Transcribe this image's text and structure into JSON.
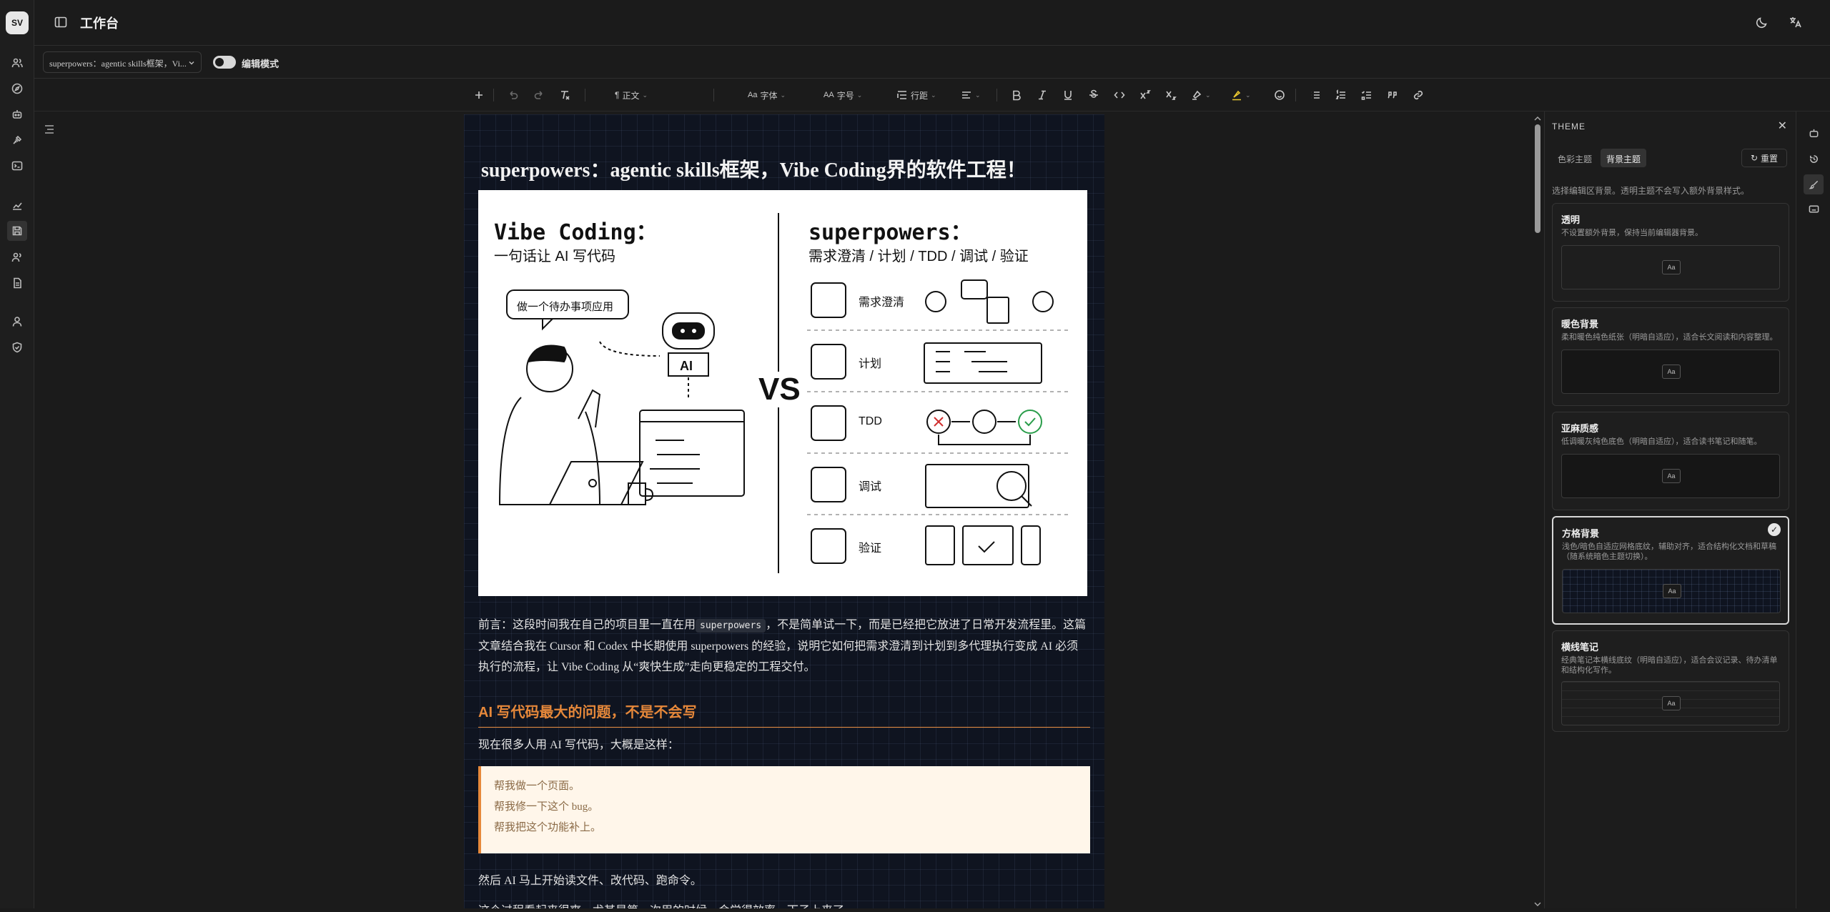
{
  "app": {
    "logo": "SV",
    "title": "工作台"
  },
  "subbar": {
    "doc_select": "superpowers：agentic skills框架，Vi...",
    "edit_mode_label": "编辑模式",
    "edit_mode_on": true
  },
  "toolbar": {
    "paragraph": "正文",
    "font": "字体",
    "font_size": "字号",
    "line_height": "行距",
    "font_prefix": "Aa",
    "size_prefix": "AA"
  },
  "document": {
    "title": "superpowers：agentic skills框架，Vibe Coding界的软件工程！",
    "hero": {
      "left_title": "Vibe Coding：",
      "left_subtitle": "一句话让 AI 写代码",
      "bubble": "做一个待办事项应用",
      "robot_label": "AI",
      "vs": "VS",
      "right_title": "superpowers：",
      "right_subtitle": "需求澄清 / 计划 / TDD / 调试 / 验证",
      "steps": [
        "需求澄清",
        "计划",
        "TDD",
        "调试",
        "验证"
      ]
    },
    "intro_before_code": "前言：这段时间我在自己的项目里一直在用",
    "intro_code": "superpowers",
    "intro_after_code": "，不是简单试一下，而是已经把它放进了日常开发流程里。这篇文章结合我在 Cursor 和 Codex 中长期使用 superpowers 的经验，说明它如何把需求澄清到计划到多代理执行变成 AI 必须执行的流程，让 Vibe Coding 从“爽快生成”走向更稳定的工程交付。",
    "heading": "AI 写代码最大的问题，不是不会写",
    "para1": "现在很多人用 AI 写代码，大概是这样：",
    "quote": [
      "帮我做一个页面。",
      "帮我修一下这个 bug。",
      "帮我把这个功能补上。"
    ],
    "para2": "然后 AI 马上开始读文件、改代码、跑命令。",
    "para3": "这个过程看起来很爽，尤其是第一次用的时候，会觉得效率一下子上来了。"
  },
  "theme_panel": {
    "title": "THEME",
    "tabs": [
      "色彩主题",
      "背景主题"
    ],
    "active_tab": "背景主题",
    "reset": "重置",
    "description": "选择编辑区背景。透明主题不会写入额外背景样式。",
    "preview_label": "Aa",
    "options": [
      {
        "name": "透明",
        "desc": "不设置额外背景，保持当前编辑器背景。",
        "selected": false
      },
      {
        "name": "暖色背景",
        "desc": "柔和暖色纯色纸张（明暗自适应），适合长文阅读和内容整理。",
        "selected": false
      },
      {
        "name": "亚麻质感",
        "desc": "低调暖灰纯色底色（明暗自适应），适合读书笔记和随笔。",
        "selected": false
      },
      {
        "name": "方格背景",
        "desc": "浅色/暗色自适应网格底纹，辅助对齐，适合结构化文档和草稿（随系统暗色主题切换）。",
        "selected": true
      },
      {
        "name": "横线笔记",
        "desc": "经典笔记本横线底纹（明暗自适应），适合会议记录、待办清单和结构化写作。",
        "selected": false
      }
    ]
  }
}
